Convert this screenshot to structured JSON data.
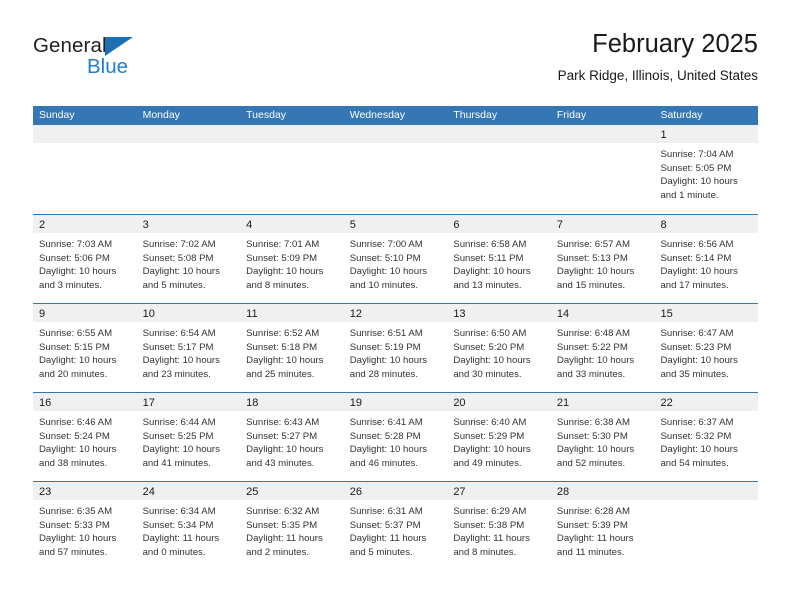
{
  "brand": {
    "name_part1": "General",
    "name_part2": "Blue",
    "triangle_color": "#1f6fb5",
    "blue_color": "#1f7fd0"
  },
  "header": {
    "month_title": "February 2025",
    "location": "Park Ridge, Illinois, United States"
  },
  "calendar": {
    "header_color": "#3576b5",
    "day_band_color": "#f0f0f0",
    "weekdays": [
      "Sunday",
      "Monday",
      "Tuesday",
      "Wednesday",
      "Thursday",
      "Friday",
      "Saturday"
    ],
    "weeks": [
      [
        {
          "empty": true
        },
        {
          "empty": true
        },
        {
          "empty": true
        },
        {
          "empty": true
        },
        {
          "empty": true
        },
        {
          "empty": true
        },
        {
          "day": "1",
          "sunrise": "Sunrise: 7:04 AM",
          "sunset": "Sunset: 5:05 PM",
          "daylight": "Daylight: 10 hours and 1 minute."
        }
      ],
      [
        {
          "day": "2",
          "sunrise": "Sunrise: 7:03 AM",
          "sunset": "Sunset: 5:06 PM",
          "daylight": "Daylight: 10 hours and 3 minutes."
        },
        {
          "day": "3",
          "sunrise": "Sunrise: 7:02 AM",
          "sunset": "Sunset: 5:08 PM",
          "daylight": "Daylight: 10 hours and 5 minutes."
        },
        {
          "day": "4",
          "sunrise": "Sunrise: 7:01 AM",
          "sunset": "Sunset: 5:09 PM",
          "daylight": "Daylight: 10 hours and 8 minutes."
        },
        {
          "day": "5",
          "sunrise": "Sunrise: 7:00 AM",
          "sunset": "Sunset: 5:10 PM",
          "daylight": "Daylight: 10 hours and 10 minutes."
        },
        {
          "day": "6",
          "sunrise": "Sunrise: 6:58 AM",
          "sunset": "Sunset: 5:11 PM",
          "daylight": "Daylight: 10 hours and 13 minutes."
        },
        {
          "day": "7",
          "sunrise": "Sunrise: 6:57 AM",
          "sunset": "Sunset: 5:13 PM",
          "daylight": "Daylight: 10 hours and 15 minutes."
        },
        {
          "day": "8",
          "sunrise": "Sunrise: 6:56 AM",
          "sunset": "Sunset: 5:14 PM",
          "daylight": "Daylight: 10 hours and 17 minutes."
        }
      ],
      [
        {
          "day": "9",
          "sunrise": "Sunrise: 6:55 AM",
          "sunset": "Sunset: 5:15 PM",
          "daylight": "Daylight: 10 hours and 20 minutes."
        },
        {
          "day": "10",
          "sunrise": "Sunrise: 6:54 AM",
          "sunset": "Sunset: 5:17 PM",
          "daylight": "Daylight: 10 hours and 23 minutes."
        },
        {
          "day": "11",
          "sunrise": "Sunrise: 6:52 AM",
          "sunset": "Sunset: 5:18 PM",
          "daylight": "Daylight: 10 hours and 25 minutes."
        },
        {
          "day": "12",
          "sunrise": "Sunrise: 6:51 AM",
          "sunset": "Sunset: 5:19 PM",
          "daylight": "Daylight: 10 hours and 28 minutes."
        },
        {
          "day": "13",
          "sunrise": "Sunrise: 6:50 AM",
          "sunset": "Sunset: 5:20 PM",
          "daylight": "Daylight: 10 hours and 30 minutes."
        },
        {
          "day": "14",
          "sunrise": "Sunrise: 6:48 AM",
          "sunset": "Sunset: 5:22 PM",
          "daylight": "Daylight: 10 hours and 33 minutes."
        },
        {
          "day": "15",
          "sunrise": "Sunrise: 6:47 AM",
          "sunset": "Sunset: 5:23 PM",
          "daylight": "Daylight: 10 hours and 35 minutes."
        }
      ],
      [
        {
          "day": "16",
          "sunrise": "Sunrise: 6:46 AM",
          "sunset": "Sunset: 5:24 PM",
          "daylight": "Daylight: 10 hours and 38 minutes."
        },
        {
          "day": "17",
          "sunrise": "Sunrise: 6:44 AM",
          "sunset": "Sunset: 5:25 PM",
          "daylight": "Daylight: 10 hours and 41 minutes."
        },
        {
          "day": "18",
          "sunrise": "Sunrise: 6:43 AM",
          "sunset": "Sunset: 5:27 PM",
          "daylight": "Daylight: 10 hours and 43 minutes."
        },
        {
          "day": "19",
          "sunrise": "Sunrise: 6:41 AM",
          "sunset": "Sunset: 5:28 PM",
          "daylight": "Daylight: 10 hours and 46 minutes."
        },
        {
          "day": "20",
          "sunrise": "Sunrise: 6:40 AM",
          "sunset": "Sunset: 5:29 PM",
          "daylight": "Daylight: 10 hours and 49 minutes."
        },
        {
          "day": "21",
          "sunrise": "Sunrise: 6:38 AM",
          "sunset": "Sunset: 5:30 PM",
          "daylight": "Daylight: 10 hours and 52 minutes."
        },
        {
          "day": "22",
          "sunrise": "Sunrise: 6:37 AM",
          "sunset": "Sunset: 5:32 PM",
          "daylight": "Daylight: 10 hours and 54 minutes."
        }
      ],
      [
        {
          "day": "23",
          "sunrise": "Sunrise: 6:35 AM",
          "sunset": "Sunset: 5:33 PM",
          "daylight": "Daylight: 10 hours and 57 minutes."
        },
        {
          "day": "24",
          "sunrise": "Sunrise: 6:34 AM",
          "sunset": "Sunset: 5:34 PM",
          "daylight": "Daylight: 11 hours and 0 minutes."
        },
        {
          "day": "25",
          "sunrise": "Sunrise: 6:32 AM",
          "sunset": "Sunset: 5:35 PM",
          "daylight": "Daylight: 11 hours and 2 minutes."
        },
        {
          "day": "26",
          "sunrise": "Sunrise: 6:31 AM",
          "sunset": "Sunset: 5:37 PM",
          "daylight": "Daylight: 11 hours and 5 minutes."
        },
        {
          "day": "27",
          "sunrise": "Sunrise: 6:29 AM",
          "sunset": "Sunset: 5:38 PM",
          "daylight": "Daylight: 11 hours and 8 minutes."
        },
        {
          "day": "28",
          "sunrise": "Sunrise: 6:28 AM",
          "sunset": "Sunset: 5:39 PM",
          "daylight": "Daylight: 11 hours and 11 minutes."
        },
        {
          "empty": true
        }
      ]
    ]
  }
}
